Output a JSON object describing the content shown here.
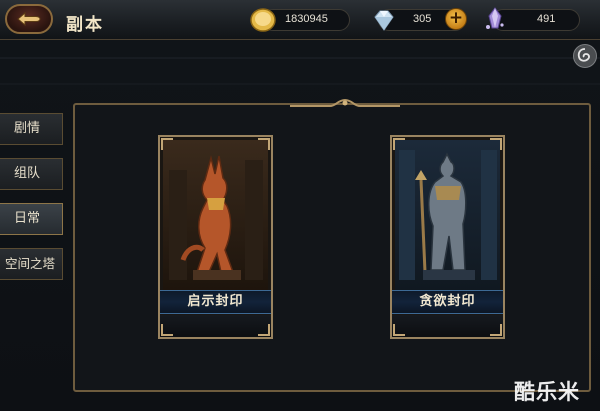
{
  "header": {
    "title": "副本",
    "back_icon": "back-arrow-icon"
  },
  "resources": {
    "gold": {
      "icon": "gold-coin-icon",
      "value": "1830945"
    },
    "diamond": {
      "icon": "diamond-icon",
      "value": "305",
      "add_label": "+"
    },
    "crystal": {
      "icon": "purple-crystal-icon",
      "value": "491"
    }
  },
  "sidebar": {
    "items": [
      {
        "label": "剧情"
      },
      {
        "label": "组队"
      },
      {
        "label": "日常",
        "active": true
      },
      {
        "label": "空间之塔"
      }
    ]
  },
  "dungeons": [
    {
      "name": "启示封印",
      "art": "anubis-jackal-statue"
    },
    {
      "name": "贪欲封印",
      "art": "armored-warrior-statue"
    }
  ],
  "watermark": "酷乐米",
  "colors": {
    "frame_gold": "#9a8460",
    "label_blue": "#12233a",
    "accent_orange": "#f4c04a"
  }
}
